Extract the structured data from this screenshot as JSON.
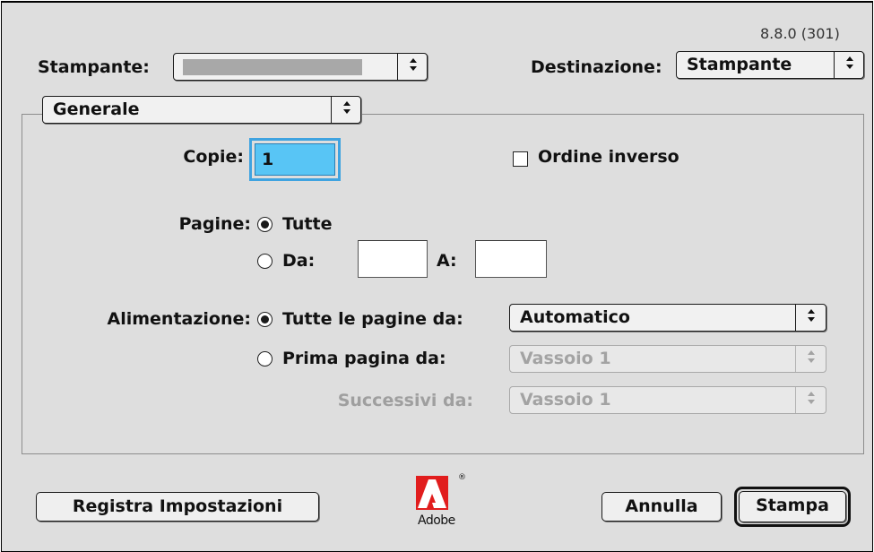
{
  "version": "8.8.0 (301)",
  "printer": {
    "label": "Stampante:",
    "selected": ""
  },
  "destination": {
    "label": "Destinazione:",
    "selected": "Stampante"
  },
  "panel": {
    "selected": "Generale"
  },
  "copies": {
    "label": "Copie:",
    "value": "1"
  },
  "reverse_order": {
    "label": "Ordine inverso",
    "checked": false
  },
  "pages": {
    "label": "Pagine:",
    "all_label": "Tutte",
    "from_label": "Da:",
    "to_label": "A:",
    "from_value": "",
    "to_value": "",
    "selected": "all"
  },
  "paper_source": {
    "label": "Alimentazione:",
    "all_pages_label": "Tutte le pagine da:",
    "all_pages_value": "Automatico",
    "first_page_label": "Prima pagina da:",
    "first_page_value": "Vassoio 1",
    "remaining_label": "Successivi da:",
    "remaining_value": "Vassoio 1",
    "selected": "all_pages"
  },
  "buttons": {
    "save_settings": "Registra Impostazioni",
    "cancel": "Annulla",
    "print": "Stampa"
  },
  "logo": {
    "text": "Adobe",
    "registered": "®"
  },
  "colors": {
    "focus": "#3fa3e0",
    "field_focus_fill": "#58c5f5",
    "printer_field_gray": "#a8a8a8"
  },
  "icons": {
    "popup_arrows": "updown-chevron-icon"
  }
}
